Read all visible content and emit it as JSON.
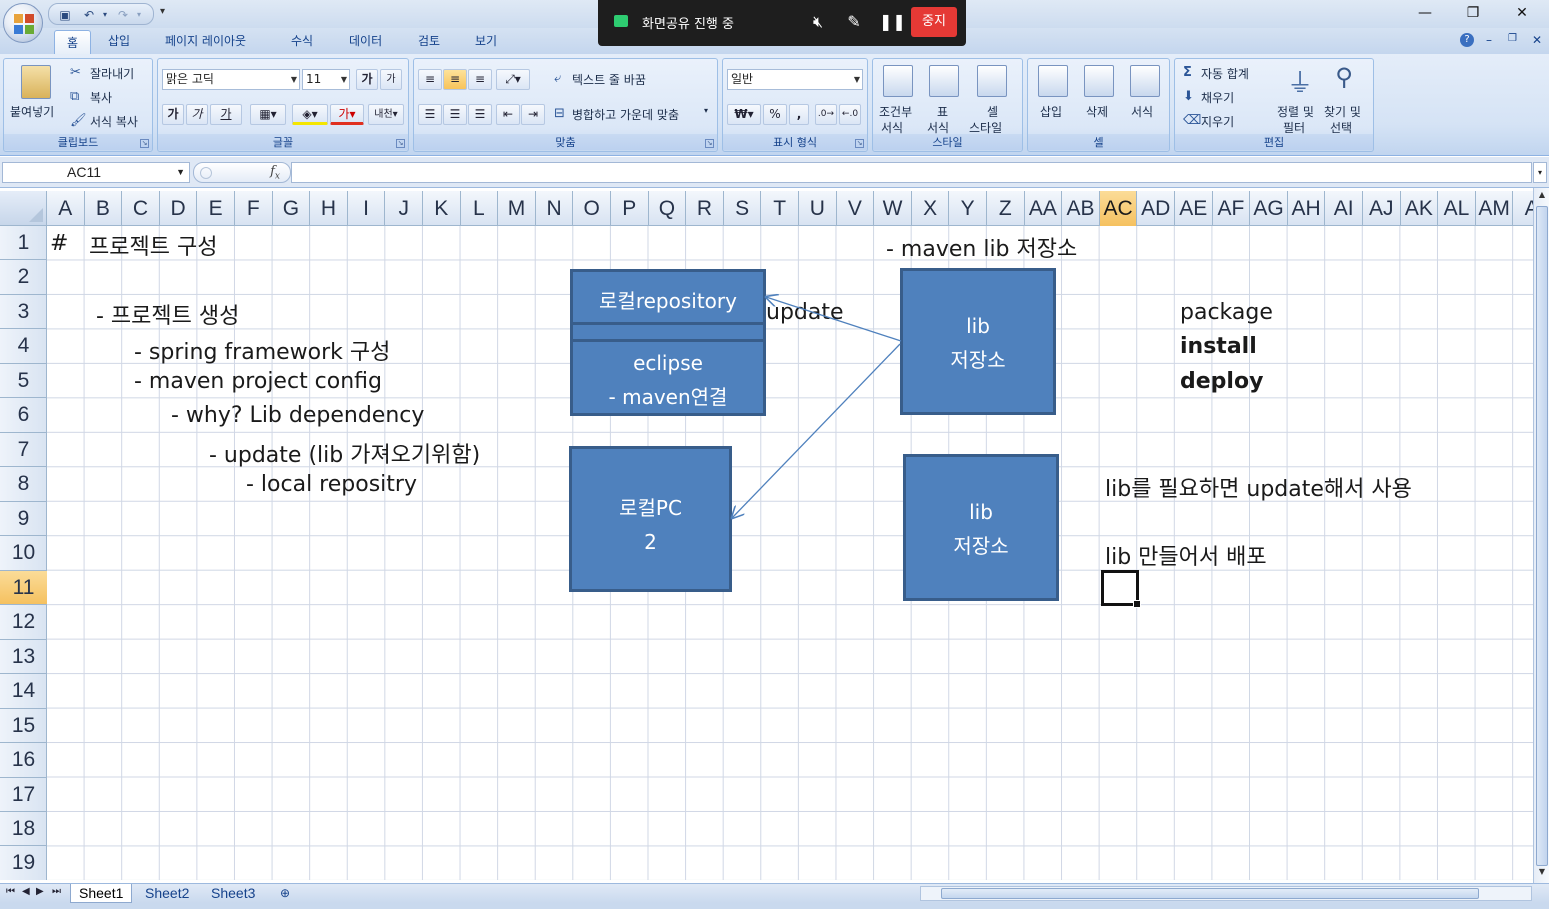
{
  "quick_access": {
    "save_icon": "save-icon",
    "undo_icon": "undo-icon",
    "redo_icon": "redo-icon"
  },
  "screen_share": {
    "status": "화면공유 진행 중",
    "stop_label": "중지"
  },
  "tabs": [
    "홈",
    "삽입",
    "페이지 레이아웃",
    "수식",
    "데이터",
    "검토",
    "보기"
  ],
  "ribbon": {
    "clipboard": {
      "paste": "붙여넣기",
      "cut": "잘라내기",
      "copy": "복사",
      "format_painter": "서식 복사",
      "label": "클립보드"
    },
    "font": {
      "name": "맑은 고딕",
      "size": "11",
      "label": "글꼴",
      "bold": "가",
      "italic": "가",
      "underline": "가"
    },
    "alignment": {
      "wrap_text": "텍스트 줄 바꿈",
      "merge_center": "병합하고 가운데 맞춤",
      "label": "맞춤"
    },
    "number": {
      "format": "일반",
      "currency": "₩",
      "percent": "%",
      "comma": ",",
      "label": "표시 형식"
    },
    "styles": {
      "conditional_1": "조건부",
      "conditional_2": "서식",
      "table_1": "표",
      "table_2": "서식",
      "cell_1": "셀",
      "cell_2": "스타일",
      "label": "스타일"
    },
    "cells": {
      "insert": "삽입",
      "delete": "삭제",
      "format": "서식",
      "label": "셀"
    },
    "editing": {
      "autosum": "자동 합계",
      "fill": "채우기",
      "clear": "지우기",
      "sort_1": "정렬 및",
      "sort_2": "필터",
      "find_1": "찾기 및",
      "find_2": "선택",
      "label": "편집"
    }
  },
  "formula_bar": {
    "name_box": "AC11",
    "fx": "fx",
    "value": ""
  },
  "columns": [
    "A",
    "B",
    "C",
    "D",
    "E",
    "F",
    "G",
    "H",
    "I",
    "J",
    "K",
    "L",
    "M",
    "N",
    "O",
    "P",
    "Q",
    "R",
    "S",
    "T",
    "U",
    "V",
    "W",
    "X",
    "Y",
    "Z",
    "AA",
    "AB",
    "AC",
    "AD",
    "AE",
    "AF",
    "AG",
    "AH",
    "AI",
    "AJ",
    "AK",
    "AL",
    "AM",
    "A"
  ],
  "selected_column": "AC",
  "rows": [
    "1",
    "2",
    "3",
    "4",
    "5",
    "6",
    "7",
    "8",
    "9",
    "10",
    "11",
    "12",
    "13",
    "14",
    "15",
    "16",
    "17",
    "18",
    "19"
  ],
  "selected_row": "11",
  "cells": {
    "a1": "#",
    "b1": "프로젝트 구성",
    "w1": "- maven lib 저장소",
    "b3": "- 프로젝트 생성",
    "c4": "- spring framework 구성",
    "c5": "- maven project config",
    "d6": "- why? Lib dependency",
    "e7": "- update (lib 가져오기위함)",
    "f8": "- local repositry",
    "u3": "update",
    "ae3": "package",
    "ae4": "install",
    "ae5": "deploy",
    "ab8": "lib를 필요하면 update해서 사용",
    "ab10": "lib 만들어서 배포"
  },
  "shapes": {
    "local_repo": "로컬repository",
    "eclipse_1": "eclipse",
    "eclipse_2": "- maven연결",
    "lib_store_1_a": "lib",
    "lib_store_1_b": "저장소",
    "local_pc_a": "로컬PC",
    "local_pc_b": "2",
    "lib_store_2_a": "lib",
    "lib_store_2_b": "저장소"
  },
  "sheets": [
    "Sheet1",
    "Sheet2",
    "Sheet3"
  ],
  "colors": {
    "shape_fill": "#4f81bd",
    "shape_border": "#385d8a",
    "selection": "#f5c160",
    "stop": "#e53935"
  }
}
